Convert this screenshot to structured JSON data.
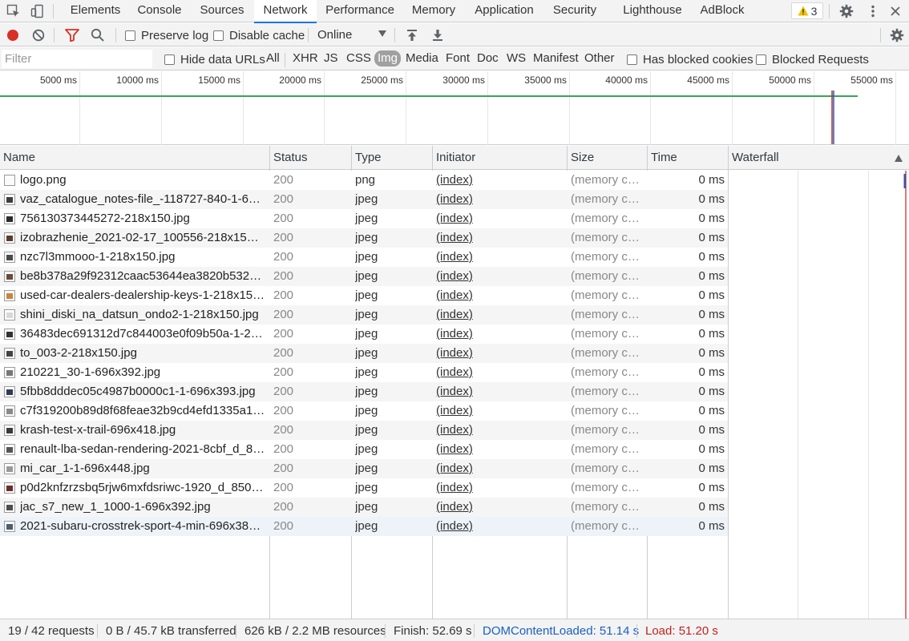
{
  "tabs": [
    {
      "label": "Elements",
      "active": false
    },
    {
      "label": "Console",
      "active": false
    },
    {
      "label": "Sources",
      "active": false
    },
    {
      "label": "Network",
      "active": true
    },
    {
      "label": "Performance",
      "active": false
    },
    {
      "label": "Memory",
      "active": false
    },
    {
      "label": "Application",
      "active": false
    },
    {
      "label": "Security",
      "active": false
    },
    {
      "label": "Lighthouse",
      "active": false
    },
    {
      "label": "AdBlock",
      "active": false
    }
  ],
  "warnings_count": "3",
  "toolbar": {
    "preserve_log": "Preserve log",
    "disable_cache": "Disable cache",
    "throttling": "Online"
  },
  "filterbar": {
    "placeholder": "Filter",
    "hide_data_urls": "Hide data URLs",
    "types": [
      "All",
      "XHR",
      "JS",
      "CSS",
      "Img",
      "Media",
      "Font",
      "Doc",
      "WS",
      "Manifest",
      "Other"
    ],
    "active_type": "Img",
    "has_blocked_cookies": "Has blocked cookies",
    "blocked_requests": "Blocked Requests"
  },
  "overview": {
    "ticks": [
      "5000 ms",
      "10000 ms",
      "15000 ms",
      "20000 ms",
      "25000 ms",
      "30000 ms",
      "35000 ms",
      "40000 ms",
      "45000 ms",
      "50000 ms",
      "55000 ms"
    ]
  },
  "columns": {
    "name": "Name",
    "status": "Status",
    "type": "Type",
    "initiator": "Initiator",
    "size": "Size",
    "time": "Time",
    "waterfall": "Waterfall"
  },
  "requests": [
    {
      "name": "logo.png",
      "status": "200",
      "type": "png",
      "initiator": "(index)",
      "size": "(memory ca...",
      "time": "0 ms"
    },
    {
      "name": "vaz_catalogue_notes-file_-118727-840-1-696x...",
      "status": "200",
      "type": "jpeg",
      "initiator": "(index)",
      "size": "(memory ca...",
      "time": "0 ms"
    },
    {
      "name": "756130373445272-218x150.jpg",
      "status": "200",
      "type": "jpeg",
      "initiator": "(index)",
      "size": "(memory ca...",
      "time": "0 ms"
    },
    {
      "name": "izobrazhenie_2021-02-17_100556-218x150.jpg",
      "status": "200",
      "type": "jpeg",
      "initiator": "(index)",
      "size": "(memory ca...",
      "time": "0 ms"
    },
    {
      "name": "nzc7l3mmooo-1-218x150.jpg",
      "status": "200",
      "type": "jpeg",
      "initiator": "(index)",
      "size": "(memory ca...",
      "time": "0 ms"
    },
    {
      "name": "be8b378a29f92312caac53644ea3820b532092...",
      "status": "200",
      "type": "jpeg",
      "initiator": "(index)",
      "size": "(memory ca...",
      "time": "0 ms"
    },
    {
      "name": "used-car-dealers-dealership-keys-1-218x150.jpg",
      "status": "200",
      "type": "jpeg",
      "initiator": "(index)",
      "size": "(memory ca...",
      "time": "0 ms"
    },
    {
      "name": "shini_diski_na_datsun_ondo2-1-218x150.jpg",
      "status": "200",
      "type": "jpeg",
      "initiator": "(index)",
      "size": "(memory ca...",
      "time": "0 ms"
    },
    {
      "name": "36483dec691312d7c844003e0f09b50a-1-218x...",
      "status": "200",
      "type": "jpeg",
      "initiator": "(index)",
      "size": "(memory ca...",
      "time": "0 ms"
    },
    {
      "name": "to_003-2-218x150.jpg",
      "status": "200",
      "type": "jpeg",
      "initiator": "(index)",
      "size": "(memory ca...",
      "time": "0 ms"
    },
    {
      "name": "210221_30-1-696x392.jpg",
      "status": "200",
      "type": "jpeg",
      "initiator": "(index)",
      "size": "(memory ca...",
      "time": "0 ms"
    },
    {
      "name": "5fbb8dddec05c4987b0000c1-1-696x393.jpg",
      "status": "200",
      "type": "jpeg",
      "initiator": "(index)",
      "size": "(memory ca...",
      "time": "0 ms"
    },
    {
      "name": "c7f319200b89d8f68feae32b9cd4efd1335a137...",
      "status": "200",
      "type": "jpeg",
      "initiator": "(index)",
      "size": "(memory ca...",
      "time": "0 ms"
    },
    {
      "name": "krash-test-x-trail-696x418.jpg",
      "status": "200",
      "type": "jpeg",
      "initiator": "(index)",
      "size": "(memory ca...",
      "time": "0 ms"
    },
    {
      "name": "renault-lba-sedan-rendering-2021-8cbf_d_850-...",
      "status": "200",
      "type": "jpeg",
      "initiator": "(index)",
      "size": "(memory ca...",
      "time": "0 ms"
    },
    {
      "name": "mi_car_1-1-696x448.jpg",
      "status": "200",
      "type": "jpeg",
      "initiator": "(index)",
      "size": "(memory ca...",
      "time": "0 ms"
    },
    {
      "name": "p0d2knfzrzsbq5rjw6mxfdsriwc-1920_d_850-69...",
      "status": "200",
      "type": "jpeg",
      "initiator": "(index)",
      "size": "(memory ca...",
      "time": "0 ms"
    },
    {
      "name": "jac_s7_new_1_1000-1-696x392.jpg",
      "status": "200",
      "type": "jpeg",
      "initiator": "(index)",
      "size": "(memory ca...",
      "time": "0 ms"
    },
    {
      "name": "2021-subaru-crosstrek-sport-4-min-696x386.jpg",
      "status": "200",
      "type": "jpeg",
      "initiator": "(index)",
      "size": "(memory ca...",
      "time": "0 ms"
    }
  ],
  "status": {
    "requests": "19 / 42 requests",
    "transferred": "0 B / 45.7 kB transferred",
    "resources": "626 kB / 2.2 MB resources",
    "finish": "Finish: 52.69 s",
    "dom_content_loaded": "DOMContentLoaded: 51.14 s",
    "load": "Load: 51.20 s"
  },
  "colors": {
    "accent": "#1a73e8",
    "record": "#d93025",
    "filter_active": "#d93025",
    "dcl": "#1a5fc4",
    "load": "#c5221f",
    "timeline_green": "#34a853"
  }
}
